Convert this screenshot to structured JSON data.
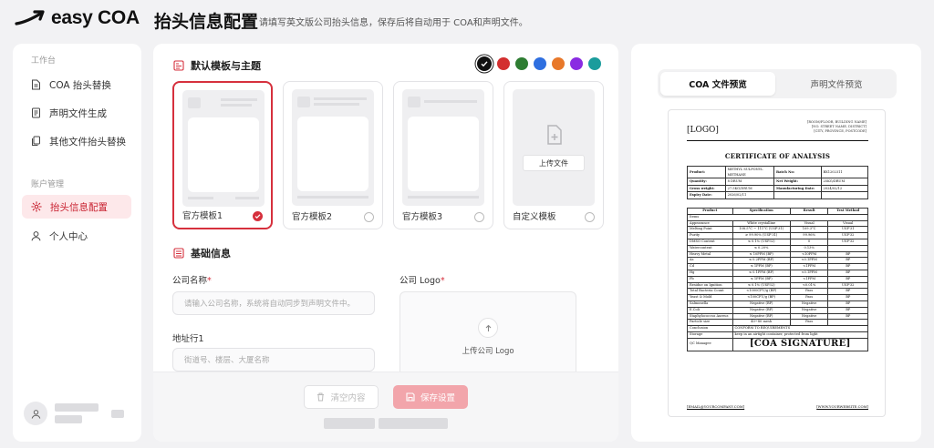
{
  "app": {
    "brand": "easy COA"
  },
  "header": {
    "title": "抬头信息配置",
    "subtitle": "请填写英文版公司抬头信息，保存后将自动用于 COA和声明文件。"
  },
  "sidebar": {
    "section_workbench": "工作台",
    "section_account": "账户管理",
    "items": [
      {
        "label": "COA 抬头替换",
        "icon": "document-icon"
      },
      {
        "label": "声明文件生成",
        "icon": "file-icon"
      },
      {
        "label": "其他文件抬头替换",
        "icon": "copy-icon"
      },
      {
        "label": "抬头信息配置",
        "icon": "gear-icon",
        "active": true
      },
      {
        "label": "个人中心",
        "icon": "user-icon"
      }
    ]
  },
  "theme": {
    "section_title": "默认模板与主题",
    "colors": [
      "#111111",
      "#d32f2f",
      "#2e7d32",
      "#2f6fe0",
      "#e8782a",
      "#8a2be2",
      "#1a9c9c"
    ],
    "selected_color": "#111111",
    "templates": [
      {
        "label": "官方模板1",
        "selected": true
      },
      {
        "label": "官方模板2",
        "selected": false
      },
      {
        "label": "官方模板3",
        "selected": false
      },
      {
        "label": "自定义模板",
        "selected": false,
        "upload_label": "上传文件"
      }
    ]
  },
  "basic": {
    "section_title": "基础信息",
    "company_name_label": "公司名称",
    "company_name_placeholder": "请输入公司名称，系统将自动同步到声明文件中。",
    "address1_label": "地址行1",
    "address1_placeholder": "街道号、楼层、大厦名称",
    "logo_label": "公司 Logo",
    "logo_upload": "上传公司 Logo",
    "required_mark": "*"
  },
  "actions": {
    "clear": "清空内容",
    "save": "保存设置"
  },
  "preview": {
    "tabs": [
      "COA 文件预览",
      "声明文件预览"
    ],
    "active_tab": 0,
    "doc": {
      "logo": "[LOGO]",
      "contact_lines": [
        "[ROOM/FLOOR, BUILDING NAME]",
        "[NO. STREET NAME, DISTRICT]",
        "[CITY, PROVINCE, POSTCODE]"
      ],
      "title": "CERTIFICATE OF ANALYSIS",
      "info_rows": [
        [
          "Product:",
          "METHYL SULFONYL METHANE",
          "Batch No:",
          "BX1202311"
        ],
        [
          "Quantity:",
          "8 DRUM",
          "Net Weight:",
          "25KG/DRUM"
        ],
        [
          "Gross weight:",
          "27.5KG/DRUM",
          "Manufacturing Date:",
          "2024/02/12"
        ],
        [
          "Expiry Date:",
          "2026/02/11",
          "",
          ""
        ]
      ],
      "result_header": [
        "Product",
        "Specification",
        "Result",
        "Test Method"
      ],
      "result_rows": [
        [
          "Items",
          "",
          "",
          ""
        ],
        [
          "Appearance",
          "White crystalline",
          "Visual",
          "Visual"
        ],
        [
          "Melting Point",
          "108.5°C ~ 111°C (USP'31)",
          "109.3°C",
          "USP'31"
        ],
        [
          "Purity",
          "≥ 99.90% (USP'31)",
          "99.96%",
          "USP'32"
        ],
        [
          "DMSO Content",
          "≤ 0.1% (USP32)",
          "0",
          "USP'32"
        ],
        [
          "Watercontent",
          "≤ 0.20%",
          "0.13%",
          ""
        ],
        [
          "Heavy Metal",
          "≤ 10PPM (BP)",
          "<10PPM",
          "BP"
        ],
        [
          "As",
          "≤ 0.2PPM (BP)",
          "<0.1PPM",
          "BP"
        ],
        [
          "Cd",
          "≤ 1PPM (BP)",
          "<1PPM",
          "BP"
        ],
        [
          "Hg",
          "≤ 0.1PPM (BP)",
          "<0.1PPM",
          "BP"
        ],
        [
          "Pb",
          "≤ 1PPM (BP)",
          "<1PPM",
          "BP"
        ],
        [
          "Residue on Ignition",
          "≤ 0.1% (USP32)",
          "<0.01%",
          "USP'32"
        ],
        [
          "Total Bacteria Count",
          "<1000CFU/g (BP)",
          "Pass",
          "BP"
        ],
        [
          "Yeast & Mold",
          "<100CFU/g (BP)",
          "Pass",
          "BP"
        ],
        [
          "Salmonella",
          "Negative (BP)",
          "Negative",
          "BP"
        ],
        [
          "E.Coli",
          "Negative (BP)",
          "Negative",
          "BP"
        ],
        [
          "Staphylococcus Aureus",
          "Negative (BP)",
          "Negative",
          "BP"
        ],
        [
          "Particle size",
          "40~80 mesh",
          "Pass",
          ""
        ],
        [
          "Conclusion",
          "CONFORM TO REQUIREMENTS",
          "",
          ""
        ],
        [
          "Storage",
          "keep in an airtight container, protected from light",
          "",
          ""
        ]
      ],
      "qc_label": "QC Manager:",
      "signature": "[COA SIGNATURE]",
      "footer_email": "[EMAIL@YOURCOMPANY.COM]",
      "footer_web": "[WWW.YOURWEBSITE.COM]"
    }
  }
}
